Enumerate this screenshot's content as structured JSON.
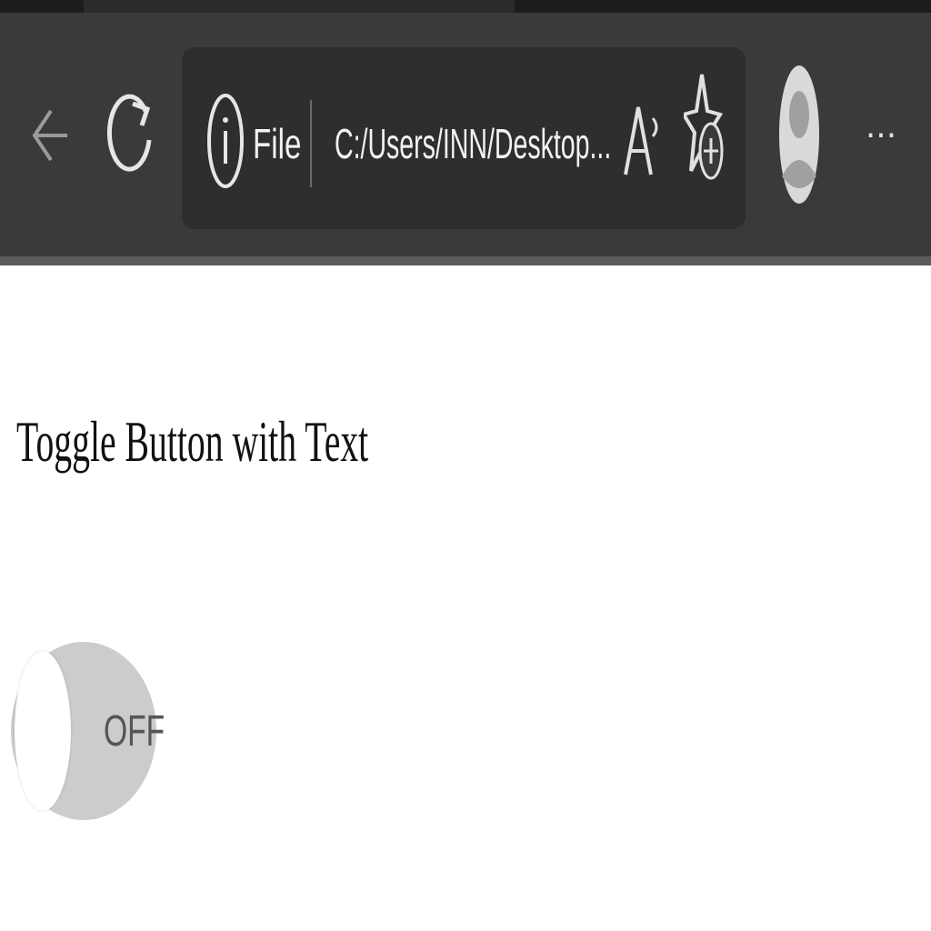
{
  "browser": {
    "address_bar": {
      "scheme_label": "File",
      "url": "C:/Users/INN/Desktop..."
    },
    "icons": {
      "back": "back-arrow-icon",
      "refresh": "refresh-icon",
      "info": "info-icon",
      "read_aloud": "read-aloud-icon",
      "favorites": "add-favorite-icon",
      "profile": "profile-avatar",
      "more": "more-icon"
    },
    "more_label": "···"
  },
  "page": {
    "title": "Toggle Button with Text",
    "toggle": {
      "state": "off",
      "label": "OFF"
    }
  },
  "colors": {
    "toolbar": "#3a3a3a",
    "address_bar": "#2e2e2e",
    "toggle_track": "#cccccc",
    "toggle_knob": "#ffffff"
  }
}
